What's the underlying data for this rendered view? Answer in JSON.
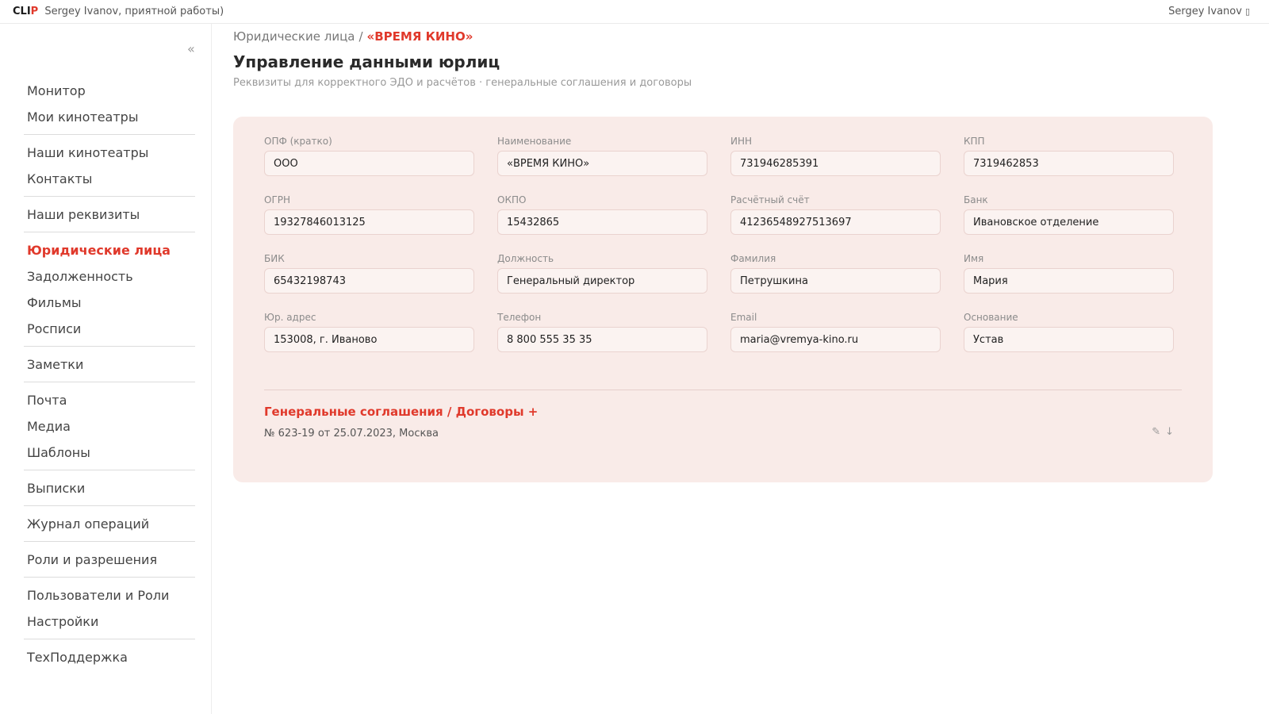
{
  "topbar": {
    "logo_part1": "CLI",
    "logo_part2": "P",
    "greeting": "Sergey Ivanov, приятной работы)",
    "user_name": "Sergey Ivanov",
    "user_caret": "▯"
  },
  "sidebar": {
    "collapse_icon": "«",
    "groups": [
      [
        "Монитор",
        "Мои кинотеатры"
      ],
      [
        "Наши кинотеатры",
        "Контакты"
      ],
      [
        "Наши реквизиты"
      ],
      [
        "Юридические лица",
        "Задолженность",
        "Фильмы",
        "Росписи"
      ],
      [
        "Заметки"
      ],
      [
        "Почта",
        "Медиа",
        "Шаблоны"
      ],
      [
        "Выписки"
      ],
      [
        "Журнал операций"
      ],
      [
        "Роли и разрешения"
      ],
      [
        "Пользователи и Роли",
        "Настройки"
      ],
      [
        "ТехПоддержка"
      ]
    ],
    "active_item": "Юридические лица"
  },
  "main": {
    "breadcrumb": {
      "parent": "Юридические лица",
      "separator": "/",
      "current": "«ВРЕМЯ КИНО»"
    },
    "title": "Управление данными юрлиц",
    "subtitle": "Реквизиты для корректного ЭДО и расчётов · генеральные соглашения и договоры",
    "fields": [
      {
        "key": "opf",
        "label": "ОПФ (кратко)",
        "value": "ООО"
      },
      {
        "key": "name",
        "label": "Наименование",
        "value": "«ВРЕМЯ КИНО»"
      },
      {
        "key": "inn",
        "label": "ИНН",
        "value": "731946285391"
      },
      {
        "key": "kpp",
        "label": "КПП",
        "value": "7319462853"
      },
      {
        "key": "ogrn",
        "label": "ОГРН",
        "value": "19327846013125"
      },
      {
        "key": "okpo",
        "label": "ОКПО",
        "value": "15432865"
      },
      {
        "key": "account",
        "label": "Расчётный счёт",
        "value": "41236548927513697"
      },
      {
        "key": "bank",
        "label": "Банк",
        "value": "Ивановское отделение"
      },
      {
        "key": "bik",
        "label": "БИК",
        "value": "65432198743"
      },
      {
        "key": "position",
        "label": "Должность",
        "value": "Генеральный директор"
      },
      {
        "key": "surname",
        "label": "Фамилия",
        "value": "Петрушкина"
      },
      {
        "key": "firstname",
        "label": "Имя",
        "value": "Мария"
      },
      {
        "key": "address",
        "label": "Юр. адрес",
        "value": "153008, г. Иваново"
      },
      {
        "key": "phone",
        "label": "Телефон",
        "value": "8 800 555 35 35"
      },
      {
        "key": "email",
        "label": "Email",
        "value": "maria@vremya-kino.ru"
      },
      {
        "key": "basis",
        "label": "Основание",
        "value": "Устав"
      }
    ],
    "agreements": {
      "title": "Генеральные соглашения / Договоры +",
      "items": [
        {
          "text": "№ 623-19 от 25.07.2023, Москва",
          "edit_icon": "✎",
          "download_icon": "↓"
        }
      ]
    }
  },
  "colors": {
    "accent": "#e0392b",
    "card_bg": "#f9ebe8",
    "input_bg": "#fbf3f1"
  }
}
